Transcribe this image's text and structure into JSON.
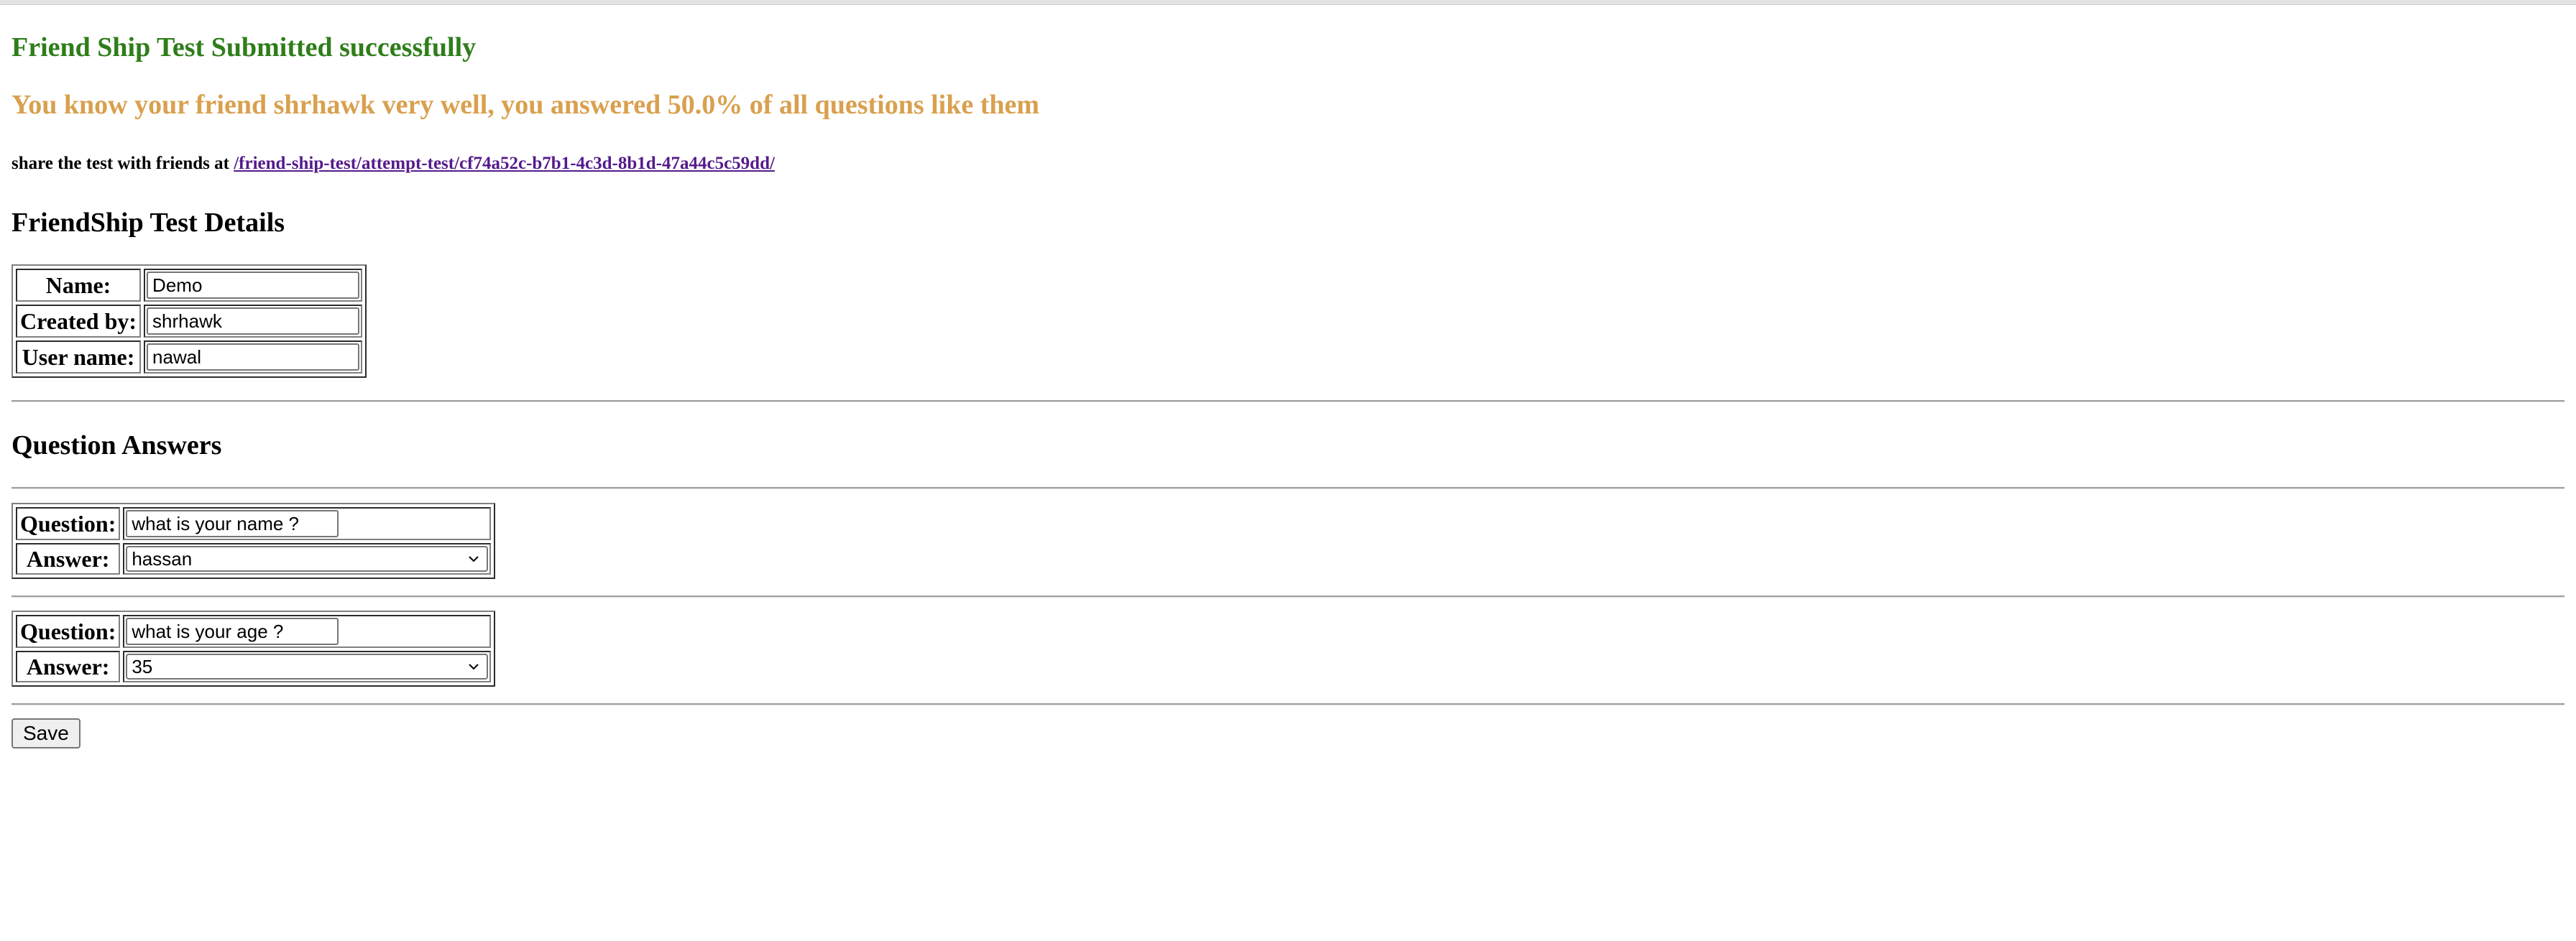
{
  "messages": {
    "success": "Friend Ship Test Submitted successfully",
    "result": "You know your friend shrhawk very well, you answered 50.0% of all questions like them",
    "share_prefix": "share the test with friends at ",
    "share_link": "/friend-ship-test/attempt-test/cf74a52c-b7b1-4c3d-8b1d-47a44c5c59dd/"
  },
  "details": {
    "title": "FriendShip Test Details",
    "rows": [
      {
        "label": "Name:",
        "value": "Demo"
      },
      {
        "label": "Created by:",
        "value": "shrhawk"
      },
      {
        "label": "User name:",
        "value": "nawal"
      }
    ]
  },
  "questions": {
    "title": "Question Answers",
    "items": [
      {
        "question_label": "Question:",
        "question": "what is your name ?",
        "answer_label": "Answer:",
        "answer": "hassan"
      },
      {
        "question_label": "Question:",
        "question": "what is your age ?",
        "answer_label": "Answer:",
        "answer": "35"
      }
    ]
  },
  "actions": {
    "save_label": "Save"
  },
  "colors": {
    "success": "#2e7d1a",
    "result": "#d9a04e",
    "link": "#551a8b"
  },
  "icons": {
    "select_arrow": "chevron-down-icon"
  }
}
